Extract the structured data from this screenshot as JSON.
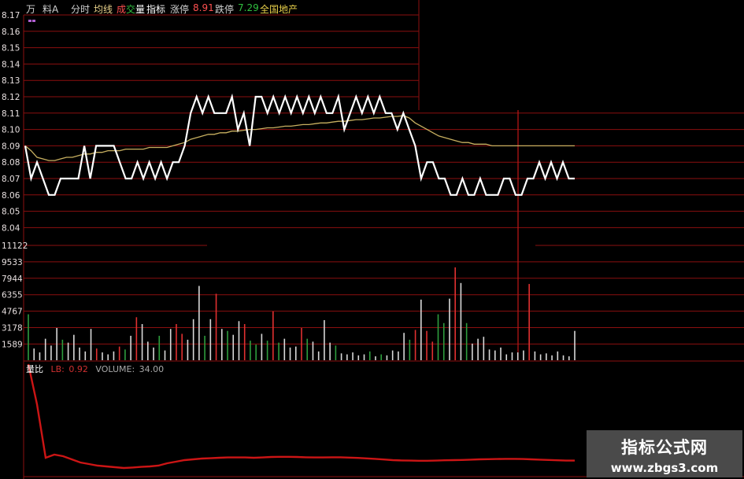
{
  "toolbar": {
    "items": [
      "万",
      "料A",
      "分时",
      "均线",
      "成交量",
      "指标",
      "涨停",
      "8.91",
      "跌停",
      "7.29",
      "全国地产"
    ],
    "wan": "万",
    "liao": "料A",
    "fenshi": "分时",
    "junxian": "均线",
    "cheng": "成",
    "jiao": "交",
    "liang": "量",
    "zhibiao": "指标",
    "zhangting_label": "涨停",
    "zhangting_value": "8.91",
    "dieting_label": "跌停",
    "dieting_value": "7.29",
    "sector": "全国地产"
  },
  "indicator": {
    "name": "量比",
    "lb_label": "LB:",
    "lb_value": "0.92",
    "volume_label": "VOLUME:",
    "volume_value": "34.00"
  },
  "watermark": {
    "title": "指标公式网",
    "url": "www.zbgs3.com"
  },
  "colors": {
    "background": "#000000",
    "grid": "#8b0f0f",
    "price_line": "#ffffff",
    "avg_line": "#c8b060",
    "vol_up": "#e03030",
    "vol_down": "#2e9e3e",
    "vol_flat": "#d8d8d8",
    "lb_line": "#cc1515",
    "axis_text": "#e8e0e0"
  },
  "chart_data": [
    {
      "type": "line",
      "name": "intraday-price",
      "y_tick_labels": [
        "8.17",
        "8.16",
        "8.15",
        "8.14",
        "8.13",
        "8.12",
        "8.11",
        "8.10",
        "8.09",
        "8.08",
        "8.07",
        "8.06",
        "8.05",
        "8.04"
      ],
      "ylim": [
        8.04,
        8.17
      ],
      "series": [
        {
          "values": [
            8.09,
            8.07,
            8.08,
            8.07,
            8.06,
            8.06,
            8.07,
            8.07,
            8.07,
            8.07,
            8.09,
            8.07,
            8.09,
            8.09,
            8.09,
            8.09,
            8.08,
            8.07,
            8.07,
            8.08,
            8.07,
            8.08,
            8.07,
            8.08,
            8.07,
            8.08,
            8.08,
            8.09,
            8.11,
            8.12,
            8.11,
            8.12,
            8.11,
            8.11,
            8.11,
            8.12,
            8.1,
            8.11,
            8.09,
            8.12,
            8.12,
            8.11,
            8.12,
            8.11,
            8.12,
            8.11,
            8.12,
            8.11,
            8.12,
            8.11,
            8.12,
            8.11,
            8.11,
            8.12,
            8.1,
            8.11,
            8.12,
            8.11,
            8.12,
            8.11,
            8.12,
            8.11,
            8.11,
            8.1,
            8.11,
            8.1,
            8.09,
            8.07,
            8.08,
            8.08,
            8.07,
            8.07,
            8.06,
            8.06,
            8.07,
            8.06,
            8.06,
            8.07,
            8.06,
            8.06,
            8.06,
            8.07,
            8.07,
            8.06,
            8.06,
            8.07,
            8.07,
            8.08,
            8.07,
            8.08,
            8.07,
            8.08,
            8.07,
            8.07
          ]
        },
        {
          "values": [
            8.09,
            8.087,
            8.083,
            8.082,
            8.081,
            8.081,
            8.082,
            8.083,
            8.083,
            8.084,
            8.085,
            8.085,
            8.086,
            8.086,
            8.087,
            8.087,
            8.087,
            8.088,
            8.088,
            8.088,
            8.088,
            8.089,
            8.089,
            8.089,
            8.089,
            8.09,
            8.091,
            8.092,
            8.094,
            8.095,
            8.096,
            8.097,
            8.097,
            8.098,
            8.098,
            8.099,
            8.099,
            8.0995,
            8.1,
            8.1,
            8.1005,
            8.101,
            8.101,
            8.1015,
            8.102,
            8.102,
            8.1025,
            8.103,
            8.103,
            8.1035,
            8.104,
            8.104,
            8.1045,
            8.105,
            8.105,
            8.1055,
            8.106,
            8.106,
            8.1065,
            8.107,
            8.107,
            8.1075,
            8.108,
            8.108,
            8.1085,
            8.107,
            8.104,
            8.102,
            8.1,
            8.098,
            8.096,
            8.095,
            8.094,
            8.093,
            8.092,
            8.092,
            8.091,
            8.091,
            8.091,
            8.09,
            8.09,
            8.09,
            8.09,
            8.09,
            8.09,
            8.09,
            8.09,
            8.09,
            8.09,
            8.09,
            8.09,
            8.09,
            8.09,
            8.09
          ]
        }
      ]
    },
    {
      "type": "bar",
      "name": "volume",
      "y_tick_labels": [
        "11122",
        "9533",
        "7944",
        "6355",
        "4767",
        "3178",
        "1589"
      ],
      "ylim": [
        0,
        12711
      ],
      "values": [
        4700,
        1200,
        800,
        2200,
        1500,
        3300,
        2100,
        1800,
        2600,
        1300,
        900,
        3200,
        1200,
        800,
        600,
        900,
        1400,
        1100,
        2500,
        4400,
        3700,
        1900,
        1300,
        2500,
        1000,
        3200,
        3700,
        2700,
        2100,
        4200,
        7600,
        2500,
        4200,
        6800,
        3200,
        3000,
        2600,
        4000,
        3700,
        2000,
        1600,
        2700,
        2000,
        5000,
        1800,
        2200,
        1300,
        1400,
        3300,
        2200,
        1900,
        900,
        4100,
        1800,
        1500,
        700,
        600,
        800,
        500,
        600,
        900,
        400,
        600,
        500,
        1000,
        900,
        2800,
        2100,
        3100,
        6200,
        3000,
        1900,
        4700,
        3800,
        6300,
        9500,
        7900,
        3800,
        1700,
        2200,
        2400,
        1100,
        1000,
        1300,
        600,
        800,
        800,
        1000,
        7800,
        900,
        600,
        700,
        500,
        900,
        500,
        400,
        3000
      ],
      "dirs": [
        "d",
        "f",
        "f",
        "f",
        "f",
        "f",
        "d",
        "f",
        "f",
        "f",
        "f",
        "f",
        "u",
        "f",
        "f",
        "f",
        "u",
        "d",
        "f",
        "u",
        "f",
        "f",
        "f",
        "d",
        "f",
        "f",
        "u",
        "u",
        "f",
        "f",
        "f",
        "d",
        "f",
        "u",
        "f",
        "d",
        "f",
        "f",
        "u",
        "d",
        "d",
        "f",
        "d",
        "u",
        "d",
        "f",
        "f",
        "f",
        "u",
        "d",
        "f",
        "f",
        "f",
        "f",
        "d",
        "f",
        "f",
        "f",
        "f",
        "f",
        "d",
        "f",
        "d",
        "f",
        "f",
        "f",
        "f",
        "d",
        "u",
        "f",
        "u",
        "u",
        "d",
        "d",
        "f",
        "u",
        "f",
        "d",
        "f",
        "f",
        "f",
        "f",
        "f",
        "f",
        "f",
        "f",
        "f",
        "f",
        "u",
        "f",
        "f",
        "f",
        "f",
        "f",
        "f",
        "f",
        "f"
      ]
    },
    {
      "type": "line",
      "name": "lb-volume-ratio",
      "values": [
        9.0,
        4.5,
        1.1,
        1.3,
        1.2,
        1.0,
        0.8,
        0.7,
        0.6,
        0.55,
        0.5,
        0.45,
        0.48,
        0.52,
        0.55,
        0.6,
        0.75,
        0.85,
        0.95,
        1.0,
        1.05,
        1.07,
        1.1,
        1.12,
        1.12,
        1.12,
        1.1,
        1.12,
        1.15,
        1.16,
        1.16,
        1.15,
        1.13,
        1.12,
        1.12,
        1.13,
        1.13,
        1.11,
        1.09,
        1.06,
        1.03,
        0.99,
        0.95,
        0.93,
        0.92,
        0.91,
        0.91,
        0.92,
        0.94,
        0.95,
        0.96,
        0.98,
        1.0,
        1.01,
        1.02,
        1.03,
        1.03,
        1.02,
        1.0,
        0.98,
        0.96,
        0.94,
        0.92,
        0.92
      ]
    }
  ]
}
